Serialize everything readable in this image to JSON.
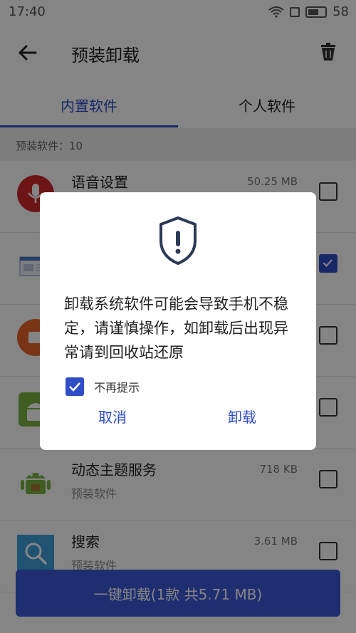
{
  "status_bar": {
    "time": "17:40",
    "battery": "58"
  },
  "header": {
    "title": "预装卸载"
  },
  "tabs": [
    {
      "label": "内置软件",
      "active": true
    },
    {
      "label": "个人软件",
      "active": false
    }
  ],
  "section": {
    "label": "预装软件：10"
  },
  "list": {
    "items": [
      {
        "name": "语音设置",
        "sub": "",
        "size": "50.25 MB",
        "icon": "microphone-icon",
        "checked": false
      },
      {
        "name": "",
        "sub": "",
        "size": "",
        "icon": "document-icon",
        "checked": true
      },
      {
        "name": "",
        "sub": "",
        "size": "",
        "icon": "orange-app-icon",
        "checked": false
      },
      {
        "name": "",
        "sub": "",
        "size": "",
        "icon": "android-icon",
        "checked": false
      },
      {
        "name": "动态主题服务",
        "sub": "预装软件",
        "size": "718 KB",
        "icon": "android-icon",
        "checked": false
      },
      {
        "name": "搜索",
        "sub": "预装软件",
        "size": "3.61 MB",
        "icon": "search-icon",
        "checked": false
      }
    ]
  },
  "bottom_button": {
    "label": "一键卸载(1款 共5.71 MB)"
  },
  "dialog": {
    "message": "卸载系统软件可能会导致手机不稳定，请谨慎操作，如卸载后出现异常请到回收站还原",
    "dont_remind_label": "不再提示",
    "dont_remind_checked": true,
    "cancel_label": "取消",
    "uninstall_label": "卸载"
  },
  "colors": {
    "accent": "#2f4ec6",
    "button": "#3b59d7",
    "overlay": "rgba(0,0,0,0.48)"
  }
}
